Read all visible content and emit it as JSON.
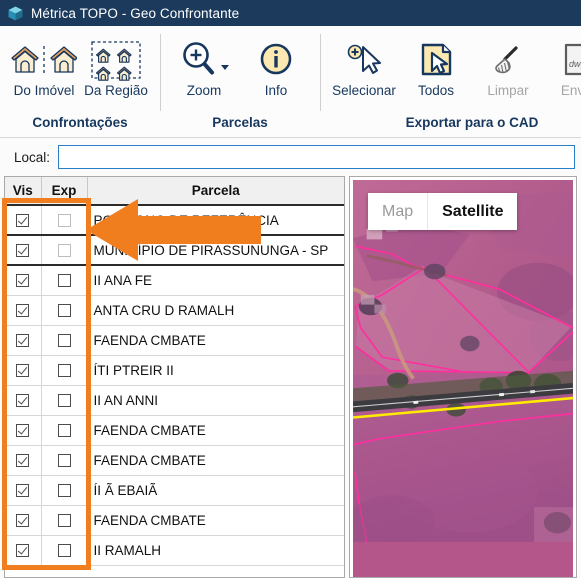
{
  "window": {
    "title": "Métrica TOPO - Geo Confrontante",
    "icon": "cube-icon",
    "titlebar_color": "#1b3a5c"
  },
  "ribbon": {
    "groups": [
      {
        "label": "Confrontações",
        "buttons": [
          {
            "caption": "Do Imóvel",
            "icon": "two-houses-divided-icon",
            "disabled": false
          },
          {
            "caption": "Da Região",
            "icon": "four-houses-selection-icon",
            "disabled": false
          }
        ]
      },
      {
        "label": "Parcelas",
        "buttons": [
          {
            "caption": "Zoom",
            "icon": "magnifier-plus-icon",
            "disabled": false,
            "has_dropdown": true
          },
          {
            "caption": "Info",
            "icon": "info-circle-icon",
            "disabled": false
          }
        ]
      },
      {
        "label": "Exportar para o CAD",
        "buttons": [
          {
            "caption": "Selecionar",
            "icon": "cursor-plus-icon",
            "disabled": false
          },
          {
            "caption": "Todos",
            "icon": "document-cursor-icon",
            "disabled": false
          },
          {
            "caption": "Limpar",
            "icon": "broom-icon",
            "disabled": true
          },
          {
            "caption": "Enviar",
            "icon": "dwg-export-icon",
            "disabled": true
          }
        ]
      }
    ]
  },
  "local_bar": {
    "label": "Local:",
    "value": "",
    "placeholder": ""
  },
  "grid": {
    "columns": [
      "Vis",
      "Exp",
      "Parcela"
    ],
    "rows": [
      {
        "vis": true,
        "exp": false,
        "exp_disabled": true,
        "name": "POLÍGONO DE REFERÊNCIA",
        "separator": true
      },
      {
        "vis": true,
        "exp": false,
        "exp_disabled": true,
        "name": "MUNICÍPIO DE PIRASSUNUNGA - SP",
        "separator": true
      },
      {
        "vis": true,
        "exp": false,
        "exp_disabled": false,
        "name": "II ANA FE",
        "separator": false
      },
      {
        "vis": true,
        "exp": false,
        "exp_disabled": false,
        "name": "ANTA CRU D RAMALH",
        "separator": false
      },
      {
        "vis": true,
        "exp": false,
        "exp_disabled": false,
        "name": "FAENDA CMBATE",
        "separator": false
      },
      {
        "vis": true,
        "exp": false,
        "exp_disabled": false,
        "name": "ÍTI PTREIR II",
        "separator": false
      },
      {
        "vis": true,
        "exp": false,
        "exp_disabled": false,
        "name": "II AN ANNI",
        "separator": false
      },
      {
        "vis": true,
        "exp": false,
        "exp_disabled": false,
        "name": "FAENDA CMBATE",
        "separator": false
      },
      {
        "vis": true,
        "exp": false,
        "exp_disabled": false,
        "name": "FAENDA CMBATE",
        "separator": false
      },
      {
        "vis": true,
        "exp": false,
        "exp_disabled": false,
        "name": "ÍI Ã EBAIÃ",
        "separator": false
      },
      {
        "vis": true,
        "exp": false,
        "exp_disabled": false,
        "name": "FAENDA CMBATE",
        "separator": false
      },
      {
        "vis": true,
        "exp": false,
        "exp_disabled": false,
        "name": "II RAMALH",
        "separator": false
      }
    ]
  },
  "map": {
    "types": [
      {
        "label": "Map",
        "active": false
      },
      {
        "label": "Satellite",
        "active": true
      }
    ],
    "parcel_outline_color": "#ff2f9e",
    "road_line_color": "#ffea00"
  },
  "annotations": {
    "highlight_color": "#f07d1e",
    "arrow": "left-arrow-annotation",
    "box": "vis-exp-columns-highlight"
  }
}
